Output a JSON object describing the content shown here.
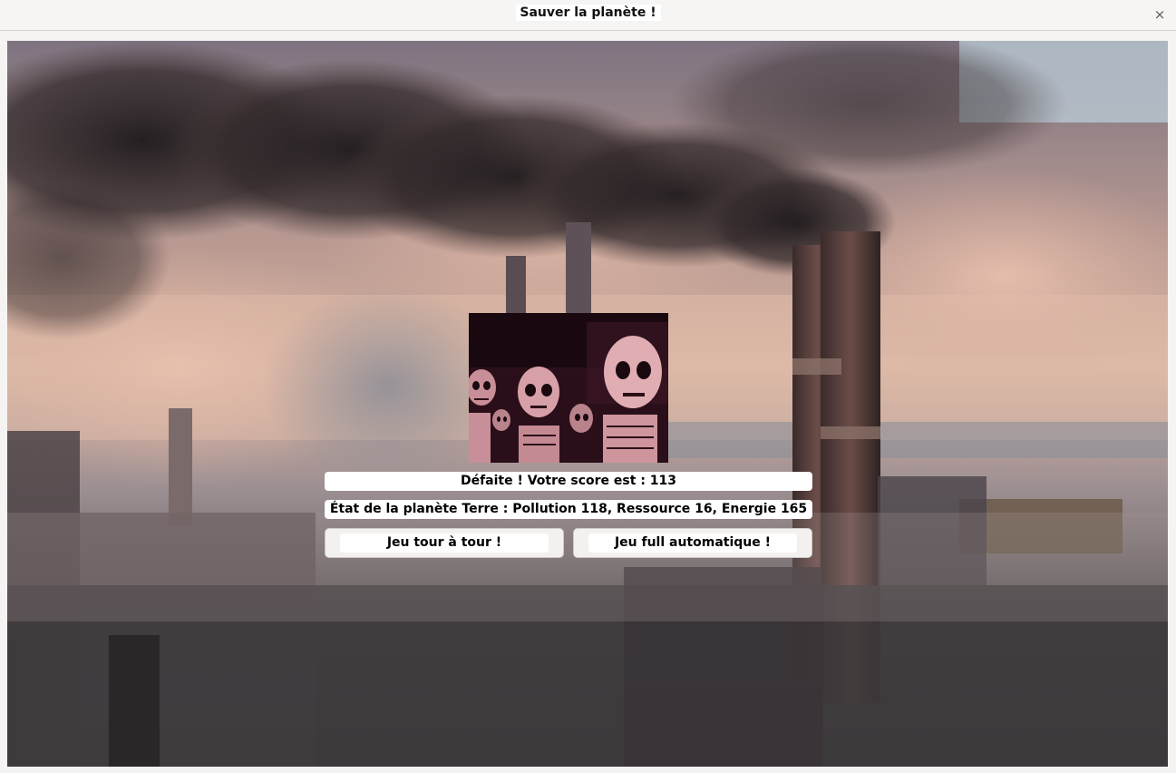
{
  "window": {
    "title": "Sauver la planète !",
    "close_glyph": "×"
  },
  "game": {
    "result_text": "Défaite ! Votre score est : 113",
    "planet_state_text": "État de la planète Terre : Pollution 118, Ressource 16, Energie 165"
  },
  "buttons": {
    "turn_based_label": "Jeu tour à tour !",
    "full_auto_label": "Jeu full automatique !"
  },
  "images": {
    "background": "industrial-smokestacks-pollution",
    "defeat_image": "dancing-skeletons"
  },
  "colors": {
    "smoke_dark": "#2a2325",
    "sky": "#b7c4cc",
    "skeleton_bone": "#d9a7ac",
    "skeleton_bg": "#2a0f1a"
  }
}
